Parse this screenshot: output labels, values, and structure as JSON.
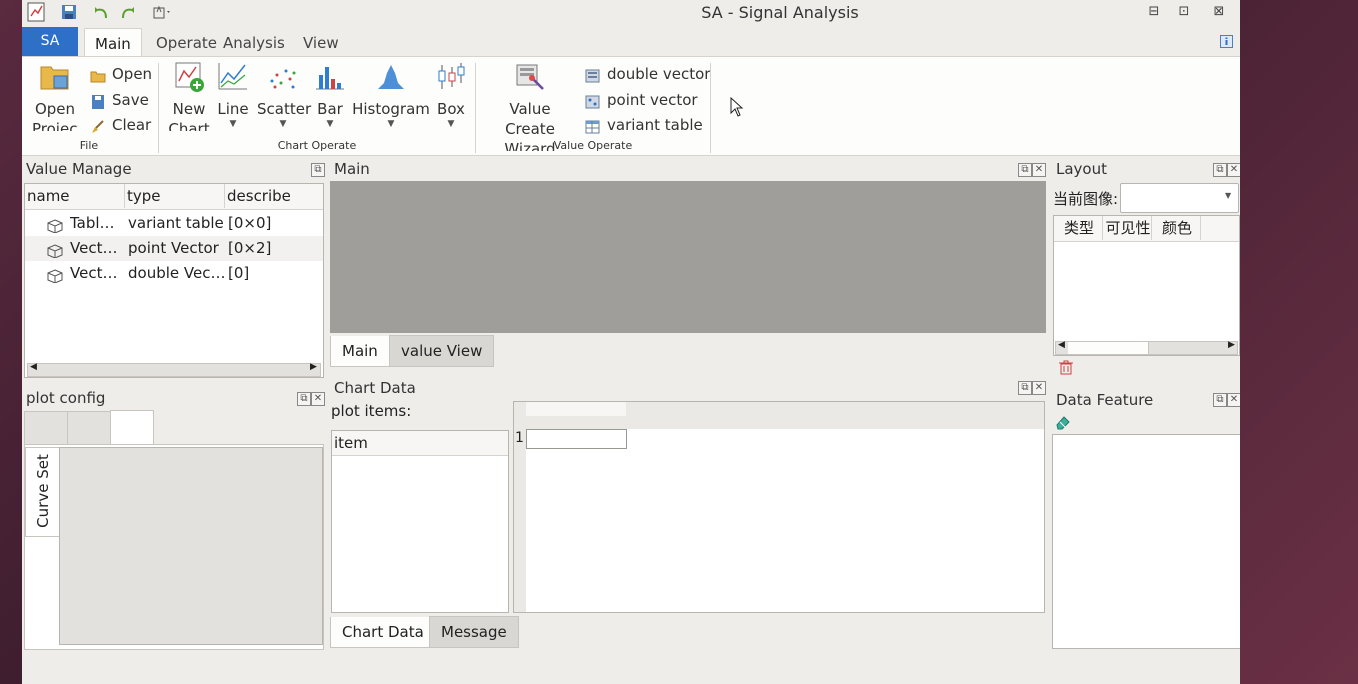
{
  "window": {
    "title": "SA - Signal Analysis",
    "controls": {
      "minimize": "⊟",
      "maximize": "⊡",
      "close": "⊠"
    }
  },
  "ribbon": {
    "app_button": "SA",
    "tabs": [
      "Main",
      "Operate",
      "Analysis",
      "View"
    ],
    "groups": {
      "file": {
        "label": "File",
        "open_project": "Open",
        "open_project_2": "Project",
        "open": "Open",
        "save": "Save",
        "clear": "Clear"
      },
      "chart_operate": {
        "label": "Chart Operate",
        "new_chart": "New",
        "new_chart_2": "Chart",
        "line": "Line",
        "scatter": "Scatter",
        "bar": "Bar",
        "histogram": "Histogram",
        "box": "Box"
      },
      "value_operate": {
        "label": "Value Operate",
        "wizard": "Value Create",
        "wizard_2": "Wizard",
        "double_vector": "double vector",
        "point_vector": "point vector",
        "variant_table": "variant table"
      }
    }
  },
  "value_manage": {
    "title": "Value Manage",
    "columns": [
      "name",
      "type",
      "describe"
    ],
    "rows": [
      {
        "name": "Tabl…",
        "type": "variant table",
        "describe": "[0×0]"
      },
      {
        "name": "Vect…",
        "type": "point Vector",
        "describe": "[0×2]"
      },
      {
        "name": "Vect…",
        "type": "double Vec…",
        "describe": "[0]"
      }
    ]
  },
  "plot_config": {
    "title": "plot config",
    "side_tab": "Curve Set"
  },
  "main_area": {
    "title": "Main",
    "tabs": [
      "Main",
      "value View"
    ]
  },
  "chart_data": {
    "title": "Chart Data",
    "plot_items_label": "plot items:",
    "item_header": "item",
    "row_number": "1",
    "tabs": [
      "Chart Data",
      "Message"
    ]
  },
  "layout": {
    "title": "Layout",
    "current_image_label": "当前图像:",
    "columns": [
      "类型",
      "可见性",
      "颜色"
    ]
  },
  "data_feature": {
    "title": "Data Feature"
  }
}
